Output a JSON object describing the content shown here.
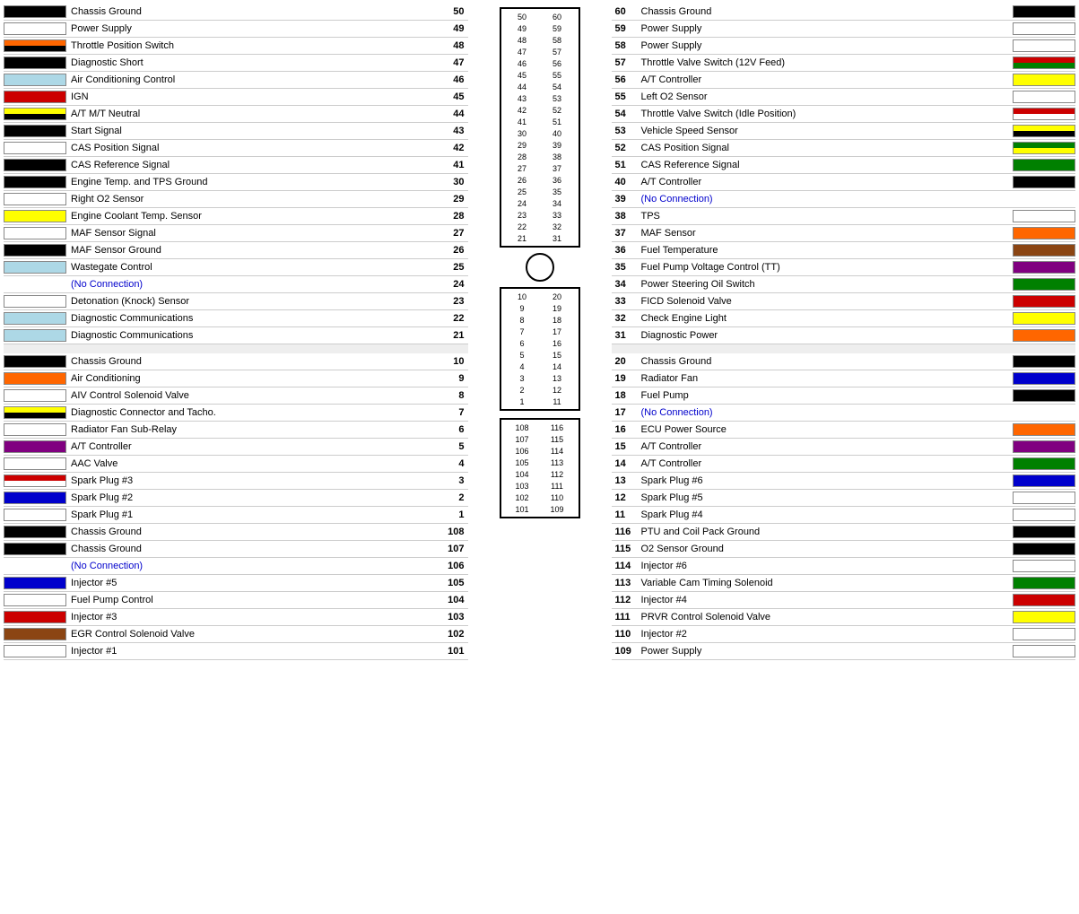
{
  "left_panel": {
    "rows": [
      {
        "pin": "50",
        "name": "Chassis Ground",
        "color": "#000000",
        "color2": null
      },
      {
        "pin": "49",
        "name": "Power Supply",
        "color": "#ffffff",
        "color2": null
      },
      {
        "pin": "48",
        "name": "Throttle Position Switch",
        "color": "#ff6600",
        "color2": "#000000",
        "stripe": true
      },
      {
        "pin": "47",
        "name": "Diagnostic Short",
        "color": "#000000",
        "color2": null
      },
      {
        "pin": "46",
        "name": "Air Conditioning Control",
        "color": "#add8e6",
        "color2": null
      },
      {
        "pin": "45",
        "name": "IGN",
        "color": "#cc0000",
        "color2": null
      },
      {
        "pin": "44",
        "name": "A/T M/T Neutral",
        "color": "#ffff00",
        "color2": "#000000",
        "stripe": true
      },
      {
        "pin": "43",
        "name": "Start Signal",
        "color": "#000000",
        "color2": null
      },
      {
        "pin": "42",
        "name": "CAS Position Signal",
        "color": "#ffffff",
        "color2": null
      },
      {
        "pin": "41",
        "name": "CAS Reference Signal",
        "color": "#000000",
        "color2": null
      },
      {
        "pin": "30",
        "name": "Engine Temp. and TPS Ground",
        "color": "#000000",
        "color2": null
      },
      {
        "pin": "29",
        "name": "Right O2 Sensor",
        "color": "#ffffff",
        "color2": null
      },
      {
        "pin": "28",
        "name": "Engine Coolant Temp. Sensor",
        "color": "#ffff00",
        "color2": null
      },
      {
        "pin": "27",
        "name": "MAF Sensor Signal",
        "color": "#ffffff",
        "color2": null
      },
      {
        "pin": "26",
        "name": "MAF Sensor Ground",
        "color": "#000000",
        "color2": null
      },
      {
        "pin": "25",
        "name": "Wastegate Control",
        "color": "#add8e6",
        "color2": null
      },
      {
        "pin": "24",
        "name": "(No Connection)",
        "color": null,
        "color2": null,
        "noconn": true
      },
      {
        "pin": "23",
        "name": "Detonation (Knock) Sensor",
        "color": "#ffffff",
        "color2": null
      },
      {
        "pin": "22",
        "name": "Diagnostic Communications",
        "color": "#add8e6",
        "color2": null
      },
      {
        "pin": "21",
        "name": "Diagnostic Communications",
        "color": "#add8e6",
        "color2": null
      },
      {
        "pin": "gap",
        "name": "",
        "color": null
      },
      {
        "pin": "10",
        "name": "Chassis Ground",
        "color": "#000000",
        "color2": null
      },
      {
        "pin": "9",
        "name": "Air Conditioning",
        "color": "#ff6600",
        "color2": null
      },
      {
        "pin": "8",
        "name": "AIV Control Solenoid Valve",
        "color": "#ffffff",
        "color2": null
      },
      {
        "pin": "7",
        "name": "Diagnostic Connector and Tacho.",
        "color": "#ffff00",
        "color2": "#000000",
        "stripe": true
      },
      {
        "pin": "6",
        "name": "Radiator Fan Sub-Relay",
        "color": "#ffffff",
        "color2": null
      },
      {
        "pin": "5",
        "name": "A/T Controller",
        "color": "#800080",
        "color2": null
      },
      {
        "pin": "4",
        "name": "AAC Valve",
        "color": "#ffffff",
        "color2": null
      },
      {
        "pin": "3",
        "name": "Spark Plug #3",
        "color": "#cc0000",
        "color2": "#ffffff",
        "stripe": true
      },
      {
        "pin": "2",
        "name": "Spark Plug #2",
        "color": "#0000cc",
        "color2": null
      },
      {
        "pin": "1",
        "name": "Spark Plug #1",
        "color": "#ffffff",
        "color2": null
      },
      {
        "pin": "108",
        "name": "Chassis Ground",
        "color": "#000000",
        "color2": null
      },
      {
        "pin": "107",
        "name": "Chassis Ground",
        "color": "#000000",
        "color2": null
      },
      {
        "pin": "106",
        "name": "(No Connection)",
        "color": null,
        "color2": null,
        "noconn": true
      },
      {
        "pin": "105",
        "name": "Injector #5",
        "color": "#0000cc",
        "color2": null
      },
      {
        "pin": "104",
        "name": "Fuel Pump Control",
        "color": "#ffffff",
        "color2": null
      },
      {
        "pin": "103",
        "name": "Injector #3",
        "color": "#cc0000",
        "color2": null
      },
      {
        "pin": "102",
        "name": "EGR Control Solenoid Valve",
        "color": "#8B4513",
        "color2": null
      },
      {
        "pin": "101",
        "name": "Injector #1",
        "color": "#ffffff",
        "color2": null
      }
    ]
  },
  "right_panel": {
    "rows": [
      {
        "pin": "60",
        "name": "Chassis Ground",
        "color": "#000000",
        "color2": null
      },
      {
        "pin": "59",
        "name": "Power Supply",
        "color": "#ffffff",
        "color2": null
      },
      {
        "pin": "58",
        "name": "Power Supply",
        "color": "#ffffff",
        "color2": null
      },
      {
        "pin": "57",
        "name": "Throttle Valve Switch (12V Feed)",
        "color": "#cc0000",
        "color2": "#008000",
        "stripe": true
      },
      {
        "pin": "56",
        "name": "A/T Controller",
        "color": "#ffff00",
        "color2": null
      },
      {
        "pin": "55",
        "name": "Left O2 Sensor",
        "color": "#ffffff",
        "color2": null
      },
      {
        "pin": "54",
        "name": "Throttle Valve Switch (Idle Position)",
        "color": "#cc0000",
        "color2": "#ffffff",
        "stripe": true
      },
      {
        "pin": "53",
        "name": "Vehicle Speed Sensor",
        "color": "#ffff00",
        "color2": "#000000",
        "stripe": true
      },
      {
        "pin": "52",
        "name": "CAS Position Signal",
        "color": "#008000",
        "color2": "#ffff00",
        "stripe": true
      },
      {
        "pin": "51",
        "name": "CAS Reference Signal",
        "color": "#008000",
        "color2": null
      },
      {
        "pin": "40",
        "name": "A/T Controller",
        "color": "#000000",
        "color2": null
      },
      {
        "pin": "39",
        "name": "(No Connection)",
        "color": null,
        "color2": null,
        "noconn": true
      },
      {
        "pin": "38",
        "name": "TPS",
        "color": "#ffffff",
        "color2": null
      },
      {
        "pin": "37",
        "name": "MAF Sensor",
        "color": "#ff6600",
        "color2": null
      },
      {
        "pin": "36",
        "name": "Fuel Temperature",
        "color": "#8B4513",
        "color2": null
      },
      {
        "pin": "35",
        "name": "Fuel Pump Voltage Control (TT)",
        "color": "#800080",
        "color2": null
      },
      {
        "pin": "34",
        "name": "Power Steering Oil Switch",
        "color": "#008000",
        "color2": null
      },
      {
        "pin": "33",
        "name": "FICD Solenoid Valve",
        "color": "#cc0000",
        "color2": null
      },
      {
        "pin": "32",
        "name": "Check Engine Light",
        "color": "#ffff00",
        "color2": null
      },
      {
        "pin": "31",
        "name": "Diagnostic Power",
        "color": "#ff6600",
        "color2": null
      },
      {
        "pin": "gap",
        "name": "",
        "color": null
      },
      {
        "pin": "20",
        "name": "Chassis Ground",
        "color": "#000000",
        "color2": null
      },
      {
        "pin": "19",
        "name": "Radiator Fan",
        "color": "#0000cc",
        "color2": null
      },
      {
        "pin": "18",
        "name": "Fuel Pump",
        "color": "#000000",
        "color2": null
      },
      {
        "pin": "17",
        "name": "(No Connection)",
        "color": null,
        "color2": null,
        "noconn": true
      },
      {
        "pin": "16",
        "name": "ECU Power Source",
        "color": "#ff6600",
        "color2": null
      },
      {
        "pin": "15",
        "name": "A/T Controller",
        "color": "#800080",
        "color2": null
      },
      {
        "pin": "14",
        "name": "A/T Controller",
        "color": "#008000",
        "color2": null
      },
      {
        "pin": "13",
        "name": "Spark Plug #6",
        "color": "#0000cc",
        "color2": null
      },
      {
        "pin": "12",
        "name": "Spark Plug #5",
        "color": "#ffffff",
        "color2": null
      },
      {
        "pin": "11",
        "name": "Spark Plug #4",
        "color": "#ffffff",
        "color2": null
      },
      {
        "pin": "116",
        "name": "PTU and Coil Pack Ground",
        "color": "#000000",
        "color2": null
      },
      {
        "pin": "115",
        "name": "O2 Sensor Ground",
        "color": "#000000",
        "color2": null
      },
      {
        "pin": "114",
        "name": "Injector #6",
        "color": "#ffffff",
        "color2": null
      },
      {
        "pin": "113",
        "name": "Variable Cam Timing Solenoid",
        "color": "#008000",
        "color2": null
      },
      {
        "pin": "112",
        "name": "Injector #4",
        "color": "#cc0000",
        "color2": null
      },
      {
        "pin": "111",
        "name": "PRVR Control Solenoid Valve",
        "color": "#ffff00",
        "color2": null
      },
      {
        "pin": "110",
        "name": "Injector #2",
        "color": "#ffffff",
        "color2": null
      },
      {
        "pin": "109",
        "name": "Power Supply",
        "color": "#ffffff",
        "color2": null
      }
    ]
  },
  "center": {
    "pin_groups_top": [
      {
        "left": "50",
        "right": "60"
      },
      {
        "left": "49",
        "right": "59"
      },
      {
        "left": "48",
        "right": "58"
      },
      {
        "left": "47",
        "right": "57"
      },
      {
        "left": "46",
        "right": "56"
      },
      {
        "left": "45",
        "right": "55"
      },
      {
        "left": "44",
        "right": "54"
      },
      {
        "left": "43",
        "right": "53"
      },
      {
        "left": "42",
        "right": "52"
      },
      {
        "left": "41",
        "right": "51"
      },
      {
        "left": "30",
        "right": "40"
      },
      {
        "left": "29",
        "right": "39"
      },
      {
        "left": "28",
        "right": "38"
      },
      {
        "left": "27",
        "right": "37"
      },
      {
        "left": "26",
        "right": "36"
      },
      {
        "left": "25",
        "right": "35"
      },
      {
        "left": "24",
        "right": "34"
      },
      {
        "left": "23",
        "right": "33"
      },
      {
        "left": "22",
        "right": "32"
      },
      {
        "left": "21",
        "right": "31"
      }
    ]
  }
}
